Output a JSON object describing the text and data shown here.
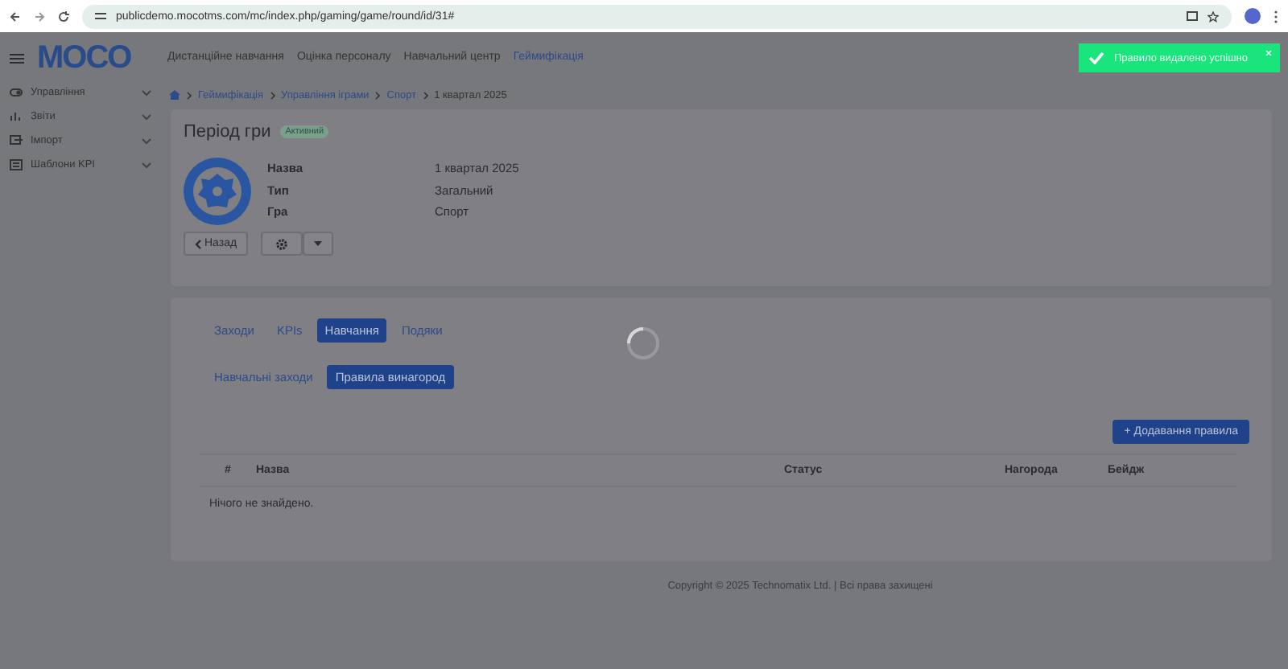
{
  "browser": {
    "url": "publicdemo.mocotms.com/mc/index.php/gaming/game/round/id/31#"
  },
  "toast": {
    "message": "Правило видалено успішно"
  },
  "header": {
    "logo": "MOCO",
    "nav": [
      {
        "label": "Дистанційне навчання",
        "selected": false
      },
      {
        "label": "Оцінка персоналу",
        "selected": false
      },
      {
        "label": "Навчальний центр",
        "selected": false
      },
      {
        "label": "Геймифікація",
        "selected": true
      }
    ]
  },
  "sidebar": {
    "items": [
      {
        "label": "Управління"
      },
      {
        "label": "Звіти"
      },
      {
        "label": "Імпорт"
      },
      {
        "label": "Шаблони KPI"
      }
    ]
  },
  "breadcrumbs": [
    "Геймифікація",
    "Управління іграми",
    "Спорт",
    "1 квартал 2025"
  ],
  "period": {
    "title": "Період гри",
    "badge": "Активний",
    "fields": [
      {
        "label": "Назва",
        "value": "1 квартал 2025"
      },
      {
        "label": "Тип",
        "value": "Загальний"
      },
      {
        "label": "Гра",
        "value": "Спорт"
      }
    ],
    "back_button": "Назад"
  },
  "tabs": [
    {
      "label": "Заходи",
      "selected": false
    },
    {
      "label": "KPIs",
      "selected": false
    },
    {
      "label": "Навчання",
      "selected": true
    },
    {
      "label": "Подяки",
      "selected": false
    }
  ],
  "subtabs": [
    {
      "label": "Навчальні заходи",
      "selected": false
    },
    {
      "label": "Правила винагород",
      "selected": true
    }
  ],
  "add_button": "+ Додавання правила",
  "table": {
    "columns": [
      "#",
      "Назва",
      "Статус",
      "Нагорода",
      "Бейдж"
    ],
    "empty_message": "Нічого не знайдено."
  },
  "footer": "Copyright © 2025 Technomatix Ltd. | Всі права захищені"
}
